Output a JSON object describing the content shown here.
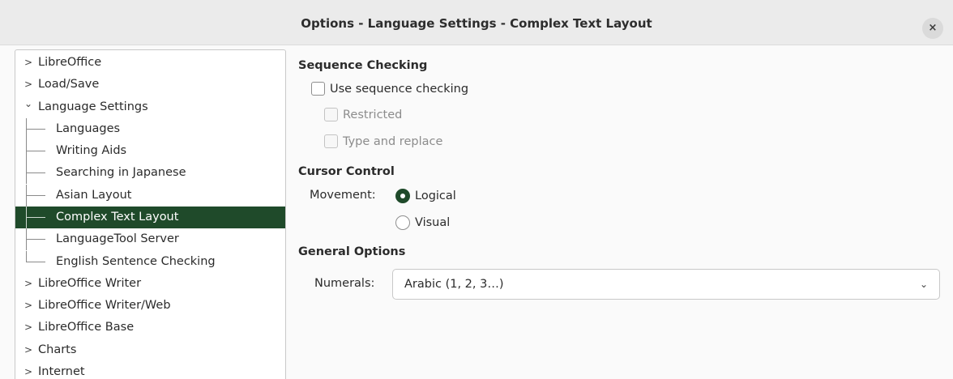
{
  "window": {
    "title": "Options - Language Settings - Complex Text Layout",
    "close_icon": "×"
  },
  "tree": {
    "items": [
      {
        "label": "LibreOffice",
        "chevron": ">"
      },
      {
        "label": "Load/Save",
        "chevron": ">"
      },
      {
        "label": "Language Settings",
        "chevron": "⌄"
      },
      {
        "label": "Languages"
      },
      {
        "label": "Writing Aids"
      },
      {
        "label": "Searching in Japanese"
      },
      {
        "label": "Asian Layout"
      },
      {
        "label": "Complex Text Layout",
        "selected": true
      },
      {
        "label": "LanguageTool Server"
      },
      {
        "label": "English Sentence Checking"
      },
      {
        "label": "LibreOffice Writer",
        "chevron": ">"
      },
      {
        "label": "LibreOffice Writer/Web",
        "chevron": ">"
      },
      {
        "label": "LibreOffice Base",
        "chevron": ">"
      },
      {
        "label": "Charts",
        "chevron": ">"
      },
      {
        "label": "Internet",
        "chevron": ">"
      }
    ]
  },
  "sequence_checking": {
    "heading": "Sequence Checking",
    "use_label": "Use sequence checking",
    "restricted_label": "Restricted",
    "type_replace_label": "Type and replace"
  },
  "cursor_control": {
    "heading": "Cursor Control",
    "movement_label": "Movement:",
    "logical_label": "Logical",
    "visual_label": "Visual"
  },
  "general_options": {
    "heading": "General Options",
    "numerals_label": "Numerals:",
    "numerals_value": "Arabic (1, 2, 3…)",
    "dropdown_icon": "⌄"
  },
  "colors": {
    "selection": "#1f4a2a",
    "titlebar": "#ebebeb"
  }
}
